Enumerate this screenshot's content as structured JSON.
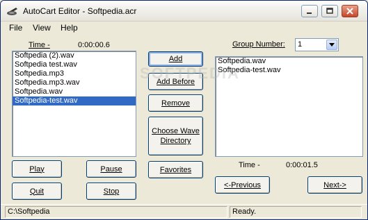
{
  "window": {
    "title": "AutoCart Editor - Softpedia.acr"
  },
  "menu": {
    "file": "File",
    "view": "View",
    "help": "Help"
  },
  "left": {
    "time_label": "Time -",
    "time_value": "0:00:00.6",
    "files": [
      "Softpedia (2).wav",
      "Softpedia test.wav",
      "Softpedia.mp3",
      "Softpedia.mp3.wav",
      "Softpedia.wav",
      "Softpedia-test.wav"
    ],
    "selected_index": 5
  },
  "middle": {
    "add": "Add",
    "add_before": "Add Before",
    "remove": "Remove",
    "choose_wave": "Choose Wave Directory",
    "favorites": "Favorites"
  },
  "right": {
    "group_label": "Group Number:",
    "group_value": "1",
    "files": [
      "Softpedia.wav",
      "Softpedia-test.wav"
    ],
    "time_label": "Time -",
    "time_value": "0:00:01.5",
    "previous": "<-Previous",
    "next": "Next->"
  },
  "controls": {
    "play": "Play",
    "pause": "Pause",
    "quit": "Quit",
    "stop": "Stop"
  },
  "status": {
    "path": "C:\\Softpedia",
    "state": "Ready."
  },
  "watermark": "SOFTPEDIA"
}
